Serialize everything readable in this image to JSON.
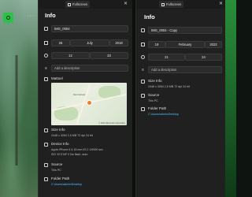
{
  "background": {
    "accent": "#2cc24a",
    "dots": "···"
  },
  "panel1": {
    "fullscreen_label": "Fullscreen",
    "close": "✕",
    "title": "Info",
    "filename": "IMG_0004",
    "date": {
      "day": "26",
      "month": "July",
      "year": "2018"
    },
    "time": {
      "hour": "12",
      "minute": "33"
    },
    "description_placeholder": "Add a description",
    "location_label": "Mattoel",
    "map": {
      "place": "Denmoshoek",
      "copyright": "© 2022 Microsoft Corporation"
    },
    "size_info": {
      "label": "Size Info",
      "value": "2448 x 3264   2,5 MB   72 dpi   24 bit"
    },
    "device_info": {
      "label": "Device Info",
      "line1": "Apple     iPhone 6    4.15 mm    f/2.2    1/9000 sec",
      "line2": "ISO 32    EXIF 0    No flash, auto"
    },
    "source": {
      "label": "Source",
      "value": "This PC"
    },
    "folder_path": {
      "label": "Folder Path",
      "value": "C:\\Users\\admin\\Desktop"
    }
  },
  "panel2": {
    "fullscreen_label": "Fullscreen",
    "close": "✕",
    "title": "Info",
    "filename": "IMG_0004 - Copy",
    "date": {
      "day": "19",
      "month": "February",
      "year": "2022"
    },
    "time": {
      "hour": "21",
      "minute": "24"
    },
    "description_placeholder": "Add a description",
    "size_info": {
      "label": "Size Info",
      "value": "2448 x 3264   2,5 MB   72 dpi   24 bit"
    },
    "source": {
      "label": "Source",
      "value": "This PC"
    },
    "folder_path": {
      "label": "Folder Path",
      "value": "C:\\Users\\admin\\Desktop"
    }
  }
}
